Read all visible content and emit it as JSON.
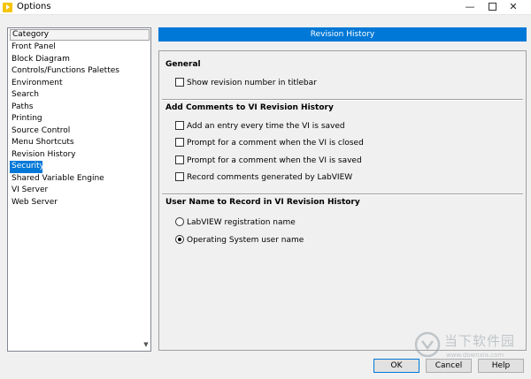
{
  "window": {
    "title": "Options",
    "minimize_glyph": "—",
    "close_glyph": "✕"
  },
  "category": {
    "header": "Category",
    "scroll_glyph": "▼",
    "items": [
      "Front Panel",
      "Block Diagram",
      "Controls/Functions Palettes",
      "Environment",
      "Search",
      "Paths",
      "Printing",
      "Source Control",
      "Menu Shortcuts",
      "Revision History",
      "Security",
      "Shared Variable Engine",
      "VI Server",
      "Web Server"
    ],
    "selected": "Security"
  },
  "panel": {
    "header": "Revision History",
    "general": {
      "title": "General",
      "show_revision": {
        "label": "Show revision number in titlebar",
        "checked": false
      }
    },
    "comments": {
      "title": "Add Comments to VI Revision History",
      "options": [
        {
          "label": "Add an entry every time the VI is saved",
          "checked": false
        },
        {
          "label": "Prompt for a comment when the VI is closed",
          "checked": false
        },
        {
          "label": "Prompt for a comment when the VI is saved",
          "checked": false
        },
        {
          "label": "Record comments generated by LabVIEW",
          "checked": false
        }
      ]
    },
    "username": {
      "title": "User Name to Record in VI Revision History",
      "options": [
        {
          "label": "LabVIEW registration name",
          "selected": false
        },
        {
          "label": "Operating System user name",
          "selected": true
        }
      ]
    }
  },
  "buttons": {
    "ok": "OK",
    "cancel": "Cancel",
    "help": "Help"
  },
  "watermark": {
    "name": "当下软件园",
    "url": "www.downxia.com"
  },
  "colors": {
    "accent": "#0078d7",
    "app_icon": "#f5c400"
  }
}
